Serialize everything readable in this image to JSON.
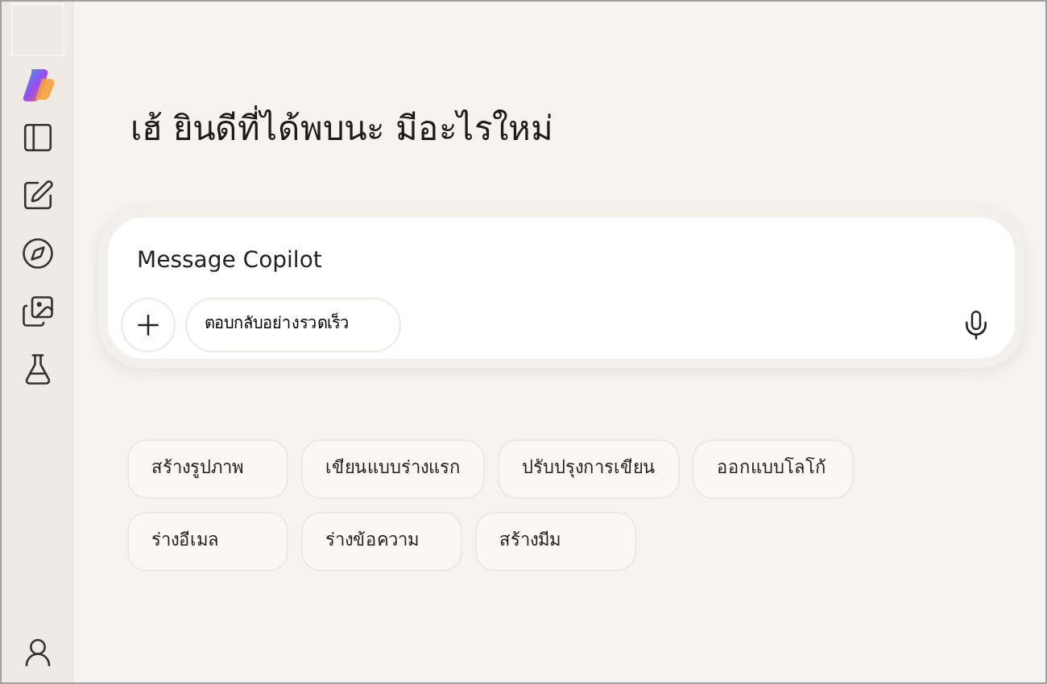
{
  "greeting": "เฮ้ ยินดีที่ได้พบนะ มีอะไรใหม่",
  "composer": {
    "placeholder": "Message Copilot",
    "mode": "ตอบกลับอย่างรวดเร็ว"
  },
  "suggestions": [
    "สร้างรูปภาพ",
    "เขียนแบบร่างแรก",
    "ปรับปรุงการเขียน",
    "ออกแบบโลโก้",
    "ร่างอีเมล",
    "ร่างข้อความ",
    "สร้างมีม"
  ]
}
